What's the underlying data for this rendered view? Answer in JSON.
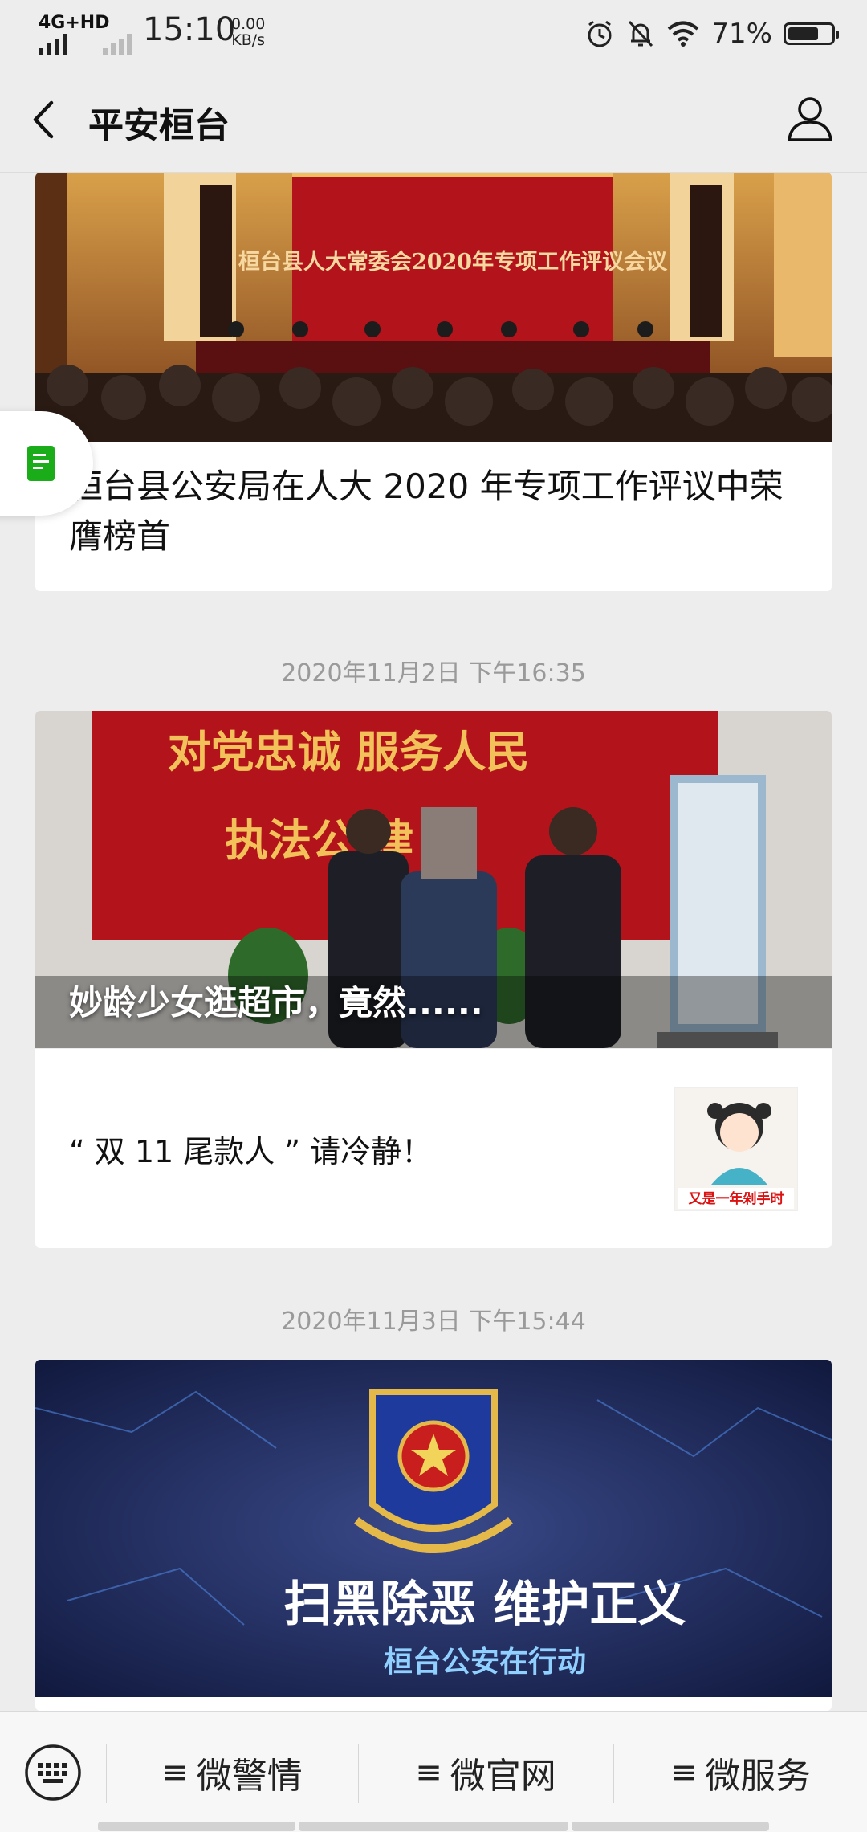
{
  "status_bar": {
    "network": "4G+HD",
    "time": "15:10",
    "speed_value": "0.00",
    "speed_unit": "KB/s",
    "battery_pct": "71%",
    "battery_level": 0.71
  },
  "header": {
    "title": "平安桓台"
  },
  "articles": [
    {
      "image_caption": "桓台县人大常委会2020年专项工作评议会议",
      "title": "桓台县公安局在人大 2020 年专项工作评议中荣膺榜首"
    },
    {
      "timestamp": "2020年11月2日 下午16:35",
      "banner_text_line1": "对党忠诚 服务人民",
      "banner_text_line2": "执法公 律 明",
      "overlay_title": "妙龄少女逛超市，竟然......",
      "sub_title": "“ 双 11 尾款人 ” 请冷静！",
      "sub_thumb_caption": "又是一年剁手时"
    },
    {
      "timestamp": "2020年11月3日 下午15:44",
      "banner_main": "扫黑除恶 维护正义",
      "banner_sub": "桓台公安在行动"
    }
  ],
  "bottom_menu": [
    {
      "label": "微警情"
    },
    {
      "label": "微官网"
    },
    {
      "label": "微服务"
    }
  ],
  "colors": {
    "background": "#ededed",
    "card": "#ffffff",
    "timestamp": "#9a9a9a",
    "accent_green": "#1aad19",
    "banner_red": "#b3141b"
  },
  "icons": {
    "back": "chevron-left-icon",
    "profile": "user-icon",
    "keyboard": "keyboard-icon",
    "doc": "document-icon"
  }
}
